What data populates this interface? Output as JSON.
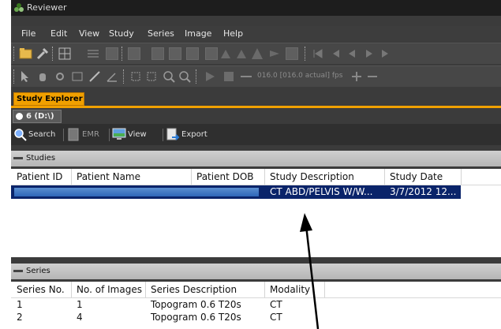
{
  "app": {
    "title": "Reviewer",
    "menu": [
      "File",
      "Edit",
      "View",
      "Study",
      "Series",
      "Image",
      "Help"
    ],
    "fps_label": "016.0 [016.0 actual] fps",
    "study_tab": "Study Explorer",
    "drive_tab": "6 (D:\\)",
    "actions": {
      "search": "Search",
      "emr": "EMR",
      "view": "View",
      "export": "Export"
    },
    "colors": {
      "accent": "#f0a000",
      "selection": "#0a246a"
    }
  },
  "studies": {
    "title": "Studies",
    "columns": [
      "Patient ID",
      "Patient Name",
      "Patient DOB",
      "Study Description",
      "Study Date"
    ],
    "rows": [
      {
        "patient_id": "",
        "patient_name": "",
        "patient_dob": "",
        "study_description": "CT ABD/PELVIS W/W...",
        "study_date": "3/7/2012 12..."
      }
    ]
  },
  "series": {
    "title": "Series",
    "columns": [
      "Series No.",
      "No. of Images",
      "Series Description",
      "Modality"
    ],
    "rows": [
      {
        "series_no": "1",
        "images": "1",
        "description": "Topogram  0.6  T20s",
        "modality": "CT"
      },
      {
        "series_no": "2",
        "images": "4",
        "description": "Topogram  0.6  T20s",
        "modality": "CT"
      }
    ]
  }
}
